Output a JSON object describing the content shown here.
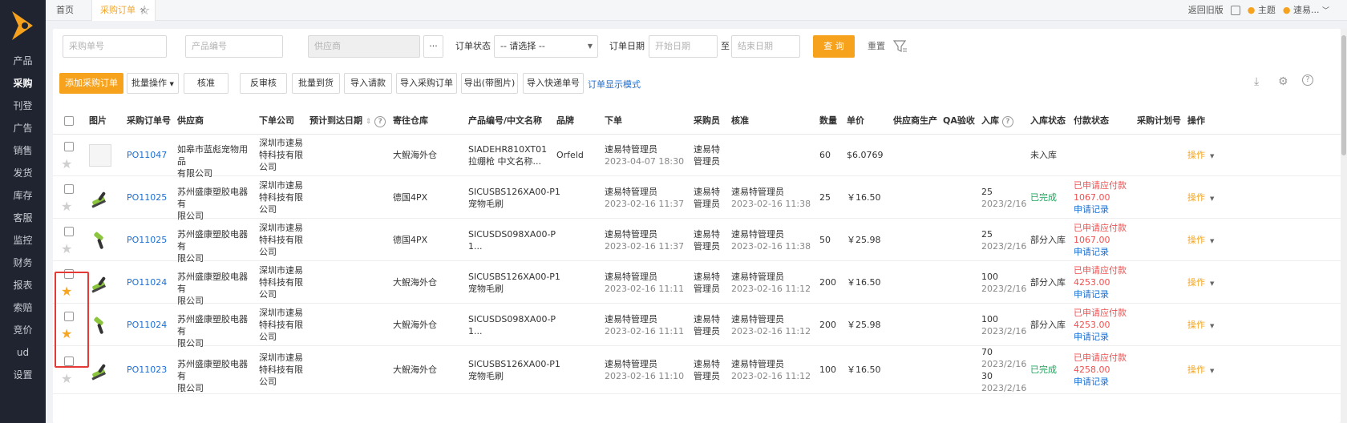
{
  "sidebar": {
    "items": [
      {
        "label": "产品"
      },
      {
        "label": "采购",
        "active": true
      },
      {
        "label": "刊登"
      },
      {
        "label": "广告"
      },
      {
        "label": "销售"
      },
      {
        "label": "发货"
      },
      {
        "label": "库存"
      },
      {
        "label": "客服"
      },
      {
        "label": "监控"
      },
      {
        "label": "财务"
      },
      {
        "label": "报表"
      },
      {
        "label": "索赔"
      },
      {
        "label": "竞价"
      },
      {
        "label": "ud"
      },
      {
        "label": "设置"
      }
    ]
  },
  "topbar": {
    "home_tab": "首页",
    "active_tab": "采购订单",
    "return_old": "返回旧版",
    "theme": "主题",
    "user": "速易..."
  },
  "filters": {
    "po_no_placeholder": "采购单号",
    "product_no_placeholder": "产品编号",
    "supplier_placeholder": "供应商",
    "supplier_more": "···",
    "status_label": "订单状态",
    "status_value": "-- 请选择 --",
    "date_label": "订单日期",
    "start_placeholder": "开始日期",
    "to_label": "至",
    "end_placeholder": "结束日期",
    "query": "查 询",
    "reset": "重置"
  },
  "toolbar": {
    "add": "添加采购订单",
    "batch": "批量操作",
    "approve": "核准",
    "unapprove": "反审核",
    "batch_arrive": "批量到货",
    "import_request": "导入请款",
    "import_po": "导入采购订单",
    "export_img": "导出(带图片)",
    "import_express": "导入快递单号",
    "display_mode": "订单显示模式"
  },
  "columns": {
    "image": "图片",
    "po_no": "采购订单号",
    "supplier": "供应商",
    "company": "下单公司",
    "eta": "预计到达日期",
    "warehouse": "寄往仓库",
    "product": "产品编号/中文名称",
    "brand": "品牌",
    "order": "下单",
    "buyer": "采购员",
    "approve": "核准",
    "qty": "数量",
    "price": "单价",
    "supplier_prod": "供应商生产",
    "qa": "QA验收",
    "inbound": "入库",
    "inbound_status": "入库状态",
    "pay_status": "付款状态",
    "plan_no": "采购计划号",
    "action": "操作"
  },
  "rows": [
    {
      "po": "PO11047",
      "supplier": [
        "如皋市蓝彪宠物用品",
        "有限公司"
      ],
      "company": [
        "深圳市速易",
        "特科技有限",
        "公司"
      ],
      "warehouse": "大鲵海外仓",
      "sku": "SIADEHR810XT01",
      "name": "拉绷枪 中文名称...",
      "brand": "Orfeld",
      "order_by": "速易特管理员",
      "order_time": "2023-04-07 18:30",
      "buyer": [
        "速易特",
        "管理员"
      ],
      "approve_by": "",
      "approve_time": "",
      "qty": "60",
      "price": "$6.0769",
      "inbound": [],
      "inbound_status": "未入库",
      "pay": [],
      "action": "操作",
      "starred": false,
      "img": "none"
    },
    {
      "po": "PO11025",
      "supplier": [
        "苏州盛康塑胶电器有",
        "限公司"
      ],
      "company": [
        "深圳市速易",
        "特科技有限",
        "公司"
      ],
      "warehouse": "德国4PX",
      "sku": "SICUSBS126XA00-P1",
      "name": "宠物毛刷",
      "brand": "",
      "order_by": "速易特管理员",
      "order_time": "2023-02-16 11:37",
      "buyer": [
        "速易特",
        "管理员"
      ],
      "approve_by": "速易特管理员",
      "approve_time": "2023-02-16 11:38",
      "qty": "25",
      "price": "￥16.50",
      "inbound": [
        "25",
        "2023/2/16"
      ],
      "inbound_status": "已完成",
      "pay": [
        "已申请应付款",
        "1067.00",
        "申请记录"
      ],
      "action": "操作",
      "starred": false,
      "img": "brush"
    },
    {
      "po": "PO11025",
      "supplier": [
        "苏州盛康塑胶电器有",
        "限公司"
      ],
      "company": [
        "深圳市速易",
        "特科技有限",
        "公司"
      ],
      "warehouse": "德国4PX",
      "sku": "SICUSDS098XA00-P",
      "name": "1...",
      "brand": "",
      "order_by": "速易特管理员",
      "order_time": "2023-02-16 11:37",
      "buyer": [
        "速易特",
        "管理员"
      ],
      "approve_by": "速易特管理员",
      "approve_time": "2023-02-16 11:38",
      "qty": "50",
      "price": "￥25.98",
      "inbound": [
        "25",
        "2023/2/16"
      ],
      "inbound_status": "部分入库",
      "pay": [
        "已申请应付款",
        "1067.00",
        "申请记录"
      ],
      "action": "操作",
      "starred": false,
      "img": "brush2"
    },
    {
      "po": "PO11024",
      "supplier": [
        "苏州盛康塑胶电器有",
        "限公司"
      ],
      "company": [
        "深圳市速易",
        "特科技有限",
        "公司"
      ],
      "warehouse": "大鲵海外仓",
      "sku": "SICUSBS126XA00-P1",
      "name": "宠物毛刷",
      "brand": "",
      "order_by": "速易特管理员",
      "order_time": "2023-02-16 11:11",
      "buyer": [
        "速易特",
        "管理员"
      ],
      "approve_by": "速易特管理员",
      "approve_time": "2023-02-16 11:12",
      "qty": "200",
      "price": "￥16.50",
      "inbound": [
        "100",
        "2023/2/16"
      ],
      "inbound_status": "部分入库",
      "pay": [
        "已申请应付款",
        "4253.00",
        "申请记录"
      ],
      "action": "操作",
      "starred": true,
      "img": "brush"
    },
    {
      "po": "PO11024",
      "supplier": [
        "苏州盛康塑胶电器有",
        "限公司"
      ],
      "company": [
        "深圳市速易",
        "特科技有限",
        "公司"
      ],
      "warehouse": "大鲵海外仓",
      "sku": "SICUSDS098XA00-P",
      "name": "1...",
      "brand": "",
      "order_by": "速易特管理员",
      "order_time": "2023-02-16 11:11",
      "buyer": [
        "速易特",
        "管理员"
      ],
      "approve_by": "速易特管理员",
      "approve_time": "2023-02-16 11:12",
      "qty": "200",
      "price": "￥25.98",
      "inbound": [
        "100",
        "2023/2/16"
      ],
      "inbound_status": "部分入库",
      "pay": [
        "已申请应付款",
        "4253.00",
        "申请记录"
      ],
      "action": "操作",
      "starred": true,
      "img": "brush2"
    },
    {
      "po": "PO11023",
      "supplier": [
        "苏州盛康塑胶电器有",
        "限公司"
      ],
      "company": [
        "深圳市速易",
        "特科技有限",
        "公司"
      ],
      "warehouse": "大鲵海外仓",
      "sku": "SICUSBS126XA00-P1",
      "name": "宠物毛刷",
      "brand": "",
      "order_by": "速易特管理员",
      "order_time": "2023-02-16 11:10",
      "buyer": [
        "速易特",
        "管理员"
      ],
      "approve_by": "速易特管理员",
      "approve_time": "2023-02-16 11:12",
      "qty": "100",
      "price": "￥16.50",
      "inbound": [
        "70",
        "2023/2/16",
        "30",
        "2023/2/16"
      ],
      "inbound_status": "已完成",
      "pay": [
        "已申请应付款",
        "4258.00",
        "申请记录"
      ],
      "action": "操作",
      "starred": false,
      "img": "brush"
    }
  ],
  "colors": {
    "accent": "#f7a21c",
    "link": "#1a6fd4",
    "success": "#19a55a",
    "danger": "#f05050",
    "sidebar": "#1f2430",
    "highlight": "#e53935"
  }
}
